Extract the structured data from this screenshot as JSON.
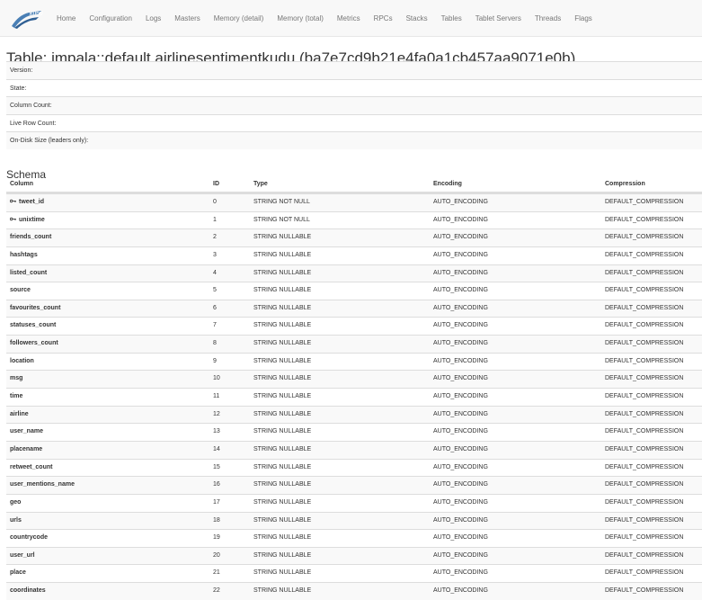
{
  "nav": {
    "logo_text": "KUDU",
    "links": [
      "Home",
      "Configuration",
      "Logs",
      "Masters",
      "Memory (detail)",
      "Memory (total)",
      "Metrics",
      "RPCs",
      "Stacks",
      "Tables",
      "Tablet Servers",
      "Threads",
      "Flags"
    ]
  },
  "page": {
    "title": "Table: impala::default.airlinesentimentkudu (ba7e7cd9b21e4fa0a1cb457aa9071e0b)"
  },
  "info": [
    {
      "label": "Version:",
      "value": ""
    },
    {
      "label": "State:",
      "value": ""
    },
    {
      "label": "Column Count:",
      "value": ""
    },
    {
      "label": "Live Row Count:",
      "value": ""
    },
    {
      "label": "On-Disk Size (leaders only):",
      "value": ""
    }
  ],
  "schema": {
    "title": "Schema",
    "headers": {
      "column": "Column",
      "id": "ID",
      "type": "Type",
      "encoding": "Encoding",
      "compression": "Compression"
    },
    "rows": [
      {
        "column": "tweet_id",
        "id": "0",
        "type": "STRING NOT NULL",
        "encoding": "AUTO_ENCODING",
        "compression": "DEFAULT_COMPRESSION",
        "key": true
      },
      {
        "column": "unixtime",
        "id": "1",
        "type": "STRING NOT NULL",
        "encoding": "AUTO_ENCODING",
        "compression": "DEFAULT_COMPRESSION",
        "key": true
      },
      {
        "column": "friends_count",
        "id": "2",
        "type": "STRING NULLABLE",
        "encoding": "AUTO_ENCODING",
        "compression": "DEFAULT_COMPRESSION",
        "key": false
      },
      {
        "column": "hashtags",
        "id": "3",
        "type": "STRING NULLABLE",
        "encoding": "AUTO_ENCODING",
        "compression": "DEFAULT_COMPRESSION",
        "key": false
      },
      {
        "column": "listed_count",
        "id": "4",
        "type": "STRING NULLABLE",
        "encoding": "AUTO_ENCODING",
        "compression": "DEFAULT_COMPRESSION",
        "key": false
      },
      {
        "column": "source",
        "id": "5",
        "type": "STRING NULLABLE",
        "encoding": "AUTO_ENCODING",
        "compression": "DEFAULT_COMPRESSION",
        "key": false
      },
      {
        "column": "favourites_count",
        "id": "6",
        "type": "STRING NULLABLE",
        "encoding": "AUTO_ENCODING",
        "compression": "DEFAULT_COMPRESSION",
        "key": false
      },
      {
        "column": "statuses_count",
        "id": "7",
        "type": "STRING NULLABLE",
        "encoding": "AUTO_ENCODING",
        "compression": "DEFAULT_COMPRESSION",
        "key": false
      },
      {
        "column": "followers_count",
        "id": "8",
        "type": "STRING NULLABLE",
        "encoding": "AUTO_ENCODING",
        "compression": "DEFAULT_COMPRESSION",
        "key": false
      },
      {
        "column": "location",
        "id": "9",
        "type": "STRING NULLABLE",
        "encoding": "AUTO_ENCODING",
        "compression": "DEFAULT_COMPRESSION",
        "key": false
      },
      {
        "column": "msg",
        "id": "10",
        "type": "STRING NULLABLE",
        "encoding": "AUTO_ENCODING",
        "compression": "DEFAULT_COMPRESSION",
        "key": false
      },
      {
        "column": "time",
        "id": "11",
        "type": "STRING NULLABLE",
        "encoding": "AUTO_ENCODING",
        "compression": "DEFAULT_COMPRESSION",
        "key": false
      },
      {
        "column": "airline",
        "id": "12",
        "type": "STRING NULLABLE",
        "encoding": "AUTO_ENCODING",
        "compression": "DEFAULT_COMPRESSION",
        "key": false
      },
      {
        "column": "user_name",
        "id": "13",
        "type": "STRING NULLABLE",
        "encoding": "AUTO_ENCODING",
        "compression": "DEFAULT_COMPRESSION",
        "key": false
      },
      {
        "column": "placename",
        "id": "14",
        "type": "STRING NULLABLE",
        "encoding": "AUTO_ENCODING",
        "compression": "DEFAULT_COMPRESSION",
        "key": false
      },
      {
        "column": "retweet_count",
        "id": "15",
        "type": "STRING NULLABLE",
        "encoding": "AUTO_ENCODING",
        "compression": "DEFAULT_COMPRESSION",
        "key": false
      },
      {
        "column": "user_mentions_name",
        "id": "16",
        "type": "STRING NULLABLE",
        "encoding": "AUTO_ENCODING",
        "compression": "DEFAULT_COMPRESSION",
        "key": false
      },
      {
        "column": "geo",
        "id": "17",
        "type": "STRING NULLABLE",
        "encoding": "AUTO_ENCODING",
        "compression": "DEFAULT_COMPRESSION",
        "key": false
      },
      {
        "column": "urls",
        "id": "18",
        "type": "STRING NULLABLE",
        "encoding": "AUTO_ENCODING",
        "compression": "DEFAULT_COMPRESSION",
        "key": false
      },
      {
        "column": "countrycode",
        "id": "19",
        "type": "STRING NULLABLE",
        "encoding": "AUTO_ENCODING",
        "compression": "DEFAULT_COMPRESSION",
        "key": false
      },
      {
        "column": "user_url",
        "id": "20",
        "type": "STRING NULLABLE",
        "encoding": "AUTO_ENCODING",
        "compression": "DEFAULT_COMPRESSION",
        "key": false
      },
      {
        "column": "place",
        "id": "21",
        "type": "STRING NULLABLE",
        "encoding": "AUTO_ENCODING",
        "compression": "DEFAULT_COMPRESSION",
        "key": false
      },
      {
        "column": "coordinates",
        "id": "22",
        "type": "STRING NULLABLE",
        "encoding": "AUTO_ENCODING",
        "compression": "DEFAULT_COMPRESSION",
        "key": false
      }
    ]
  },
  "colors": {
    "navbar_bg": "#f8f8f8",
    "nav_link": "#777777",
    "row_stripe": "#f9f9f9",
    "border": "#dddddd",
    "logo_blue": "#4a7fb5"
  },
  "icons": {
    "logo": "kudu-logo",
    "key": "key-icon"
  }
}
